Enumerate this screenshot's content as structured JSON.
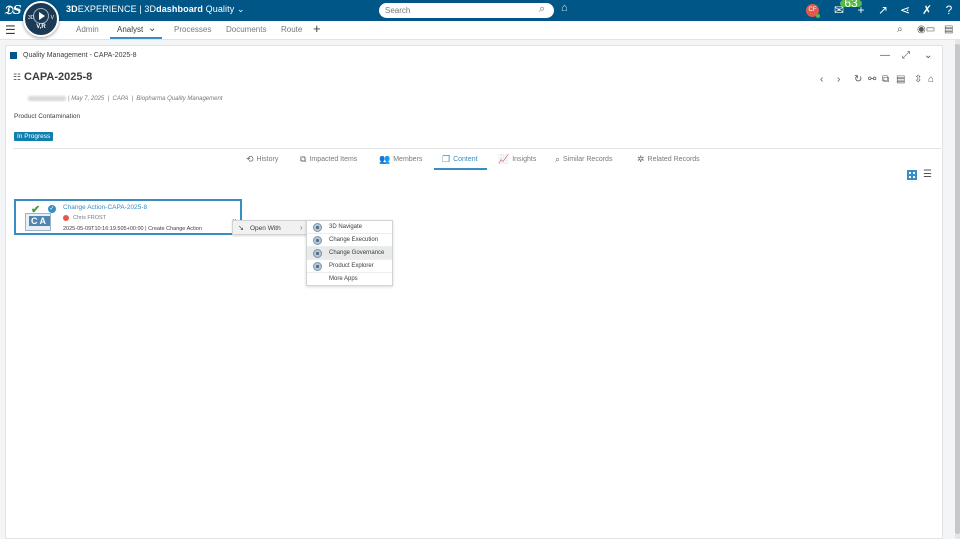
{
  "topbar": {
    "brand_prefix": "3D",
    "brand_main": "EXPERIENCE | 3D",
    "brand_app": "dashboard",
    "brand_suffix": "Quality",
    "compass_version": "V,R",
    "compass_left": "3D",
    "compass_right": "V",
    "search_placeholder": "Search",
    "avatar_initials": "CF",
    "notif_count": "63",
    "colors": {
      "bar": "#005686",
      "accent": "#368ec4",
      "status": "#0f7fad"
    }
  },
  "tabs": [
    {
      "label": "Admin"
    },
    {
      "label": "Analyst"
    },
    {
      "label": "Processes"
    },
    {
      "label": "Documents"
    },
    {
      "label": "Route"
    }
  ],
  "widget": {
    "title": "Quality Management - CAPA-2025-8"
  },
  "record": {
    "title": "CAPA-2025-8",
    "date": "May 7, 2025",
    "type": "CAPA",
    "org": "Biopharma Quality Management",
    "description": "Product Contamination",
    "status": "In Progress"
  },
  "subtabs": [
    {
      "label": "History",
      "icon": "history-icon"
    },
    {
      "label": "Impacted Items",
      "icon": "impacted-items-icon"
    },
    {
      "label": "Members",
      "icon": "members-icon"
    },
    {
      "label": "Content",
      "icon": "content-icon"
    },
    {
      "label": "Insights",
      "icon": "insights-icon"
    },
    {
      "label": "Similar Records",
      "icon": "similar-records-icon"
    },
    {
      "label": "Related Records",
      "icon": "related-records-icon"
    }
  ],
  "tile": {
    "name": "Change Action-CAPA-2025-8",
    "owner": "Chris FROST",
    "info": "2025-05-09T10:16:19.505+00:00 | Create Change Action",
    "thumb_label": "CA"
  },
  "context_menu": {
    "open_with": "Open With",
    "items": [
      {
        "label": "3D Navigate"
      },
      {
        "label": "Change Execution"
      },
      {
        "label": "Change Governance"
      },
      {
        "label": "Product Explorer"
      },
      {
        "label": "More Apps"
      }
    ]
  }
}
